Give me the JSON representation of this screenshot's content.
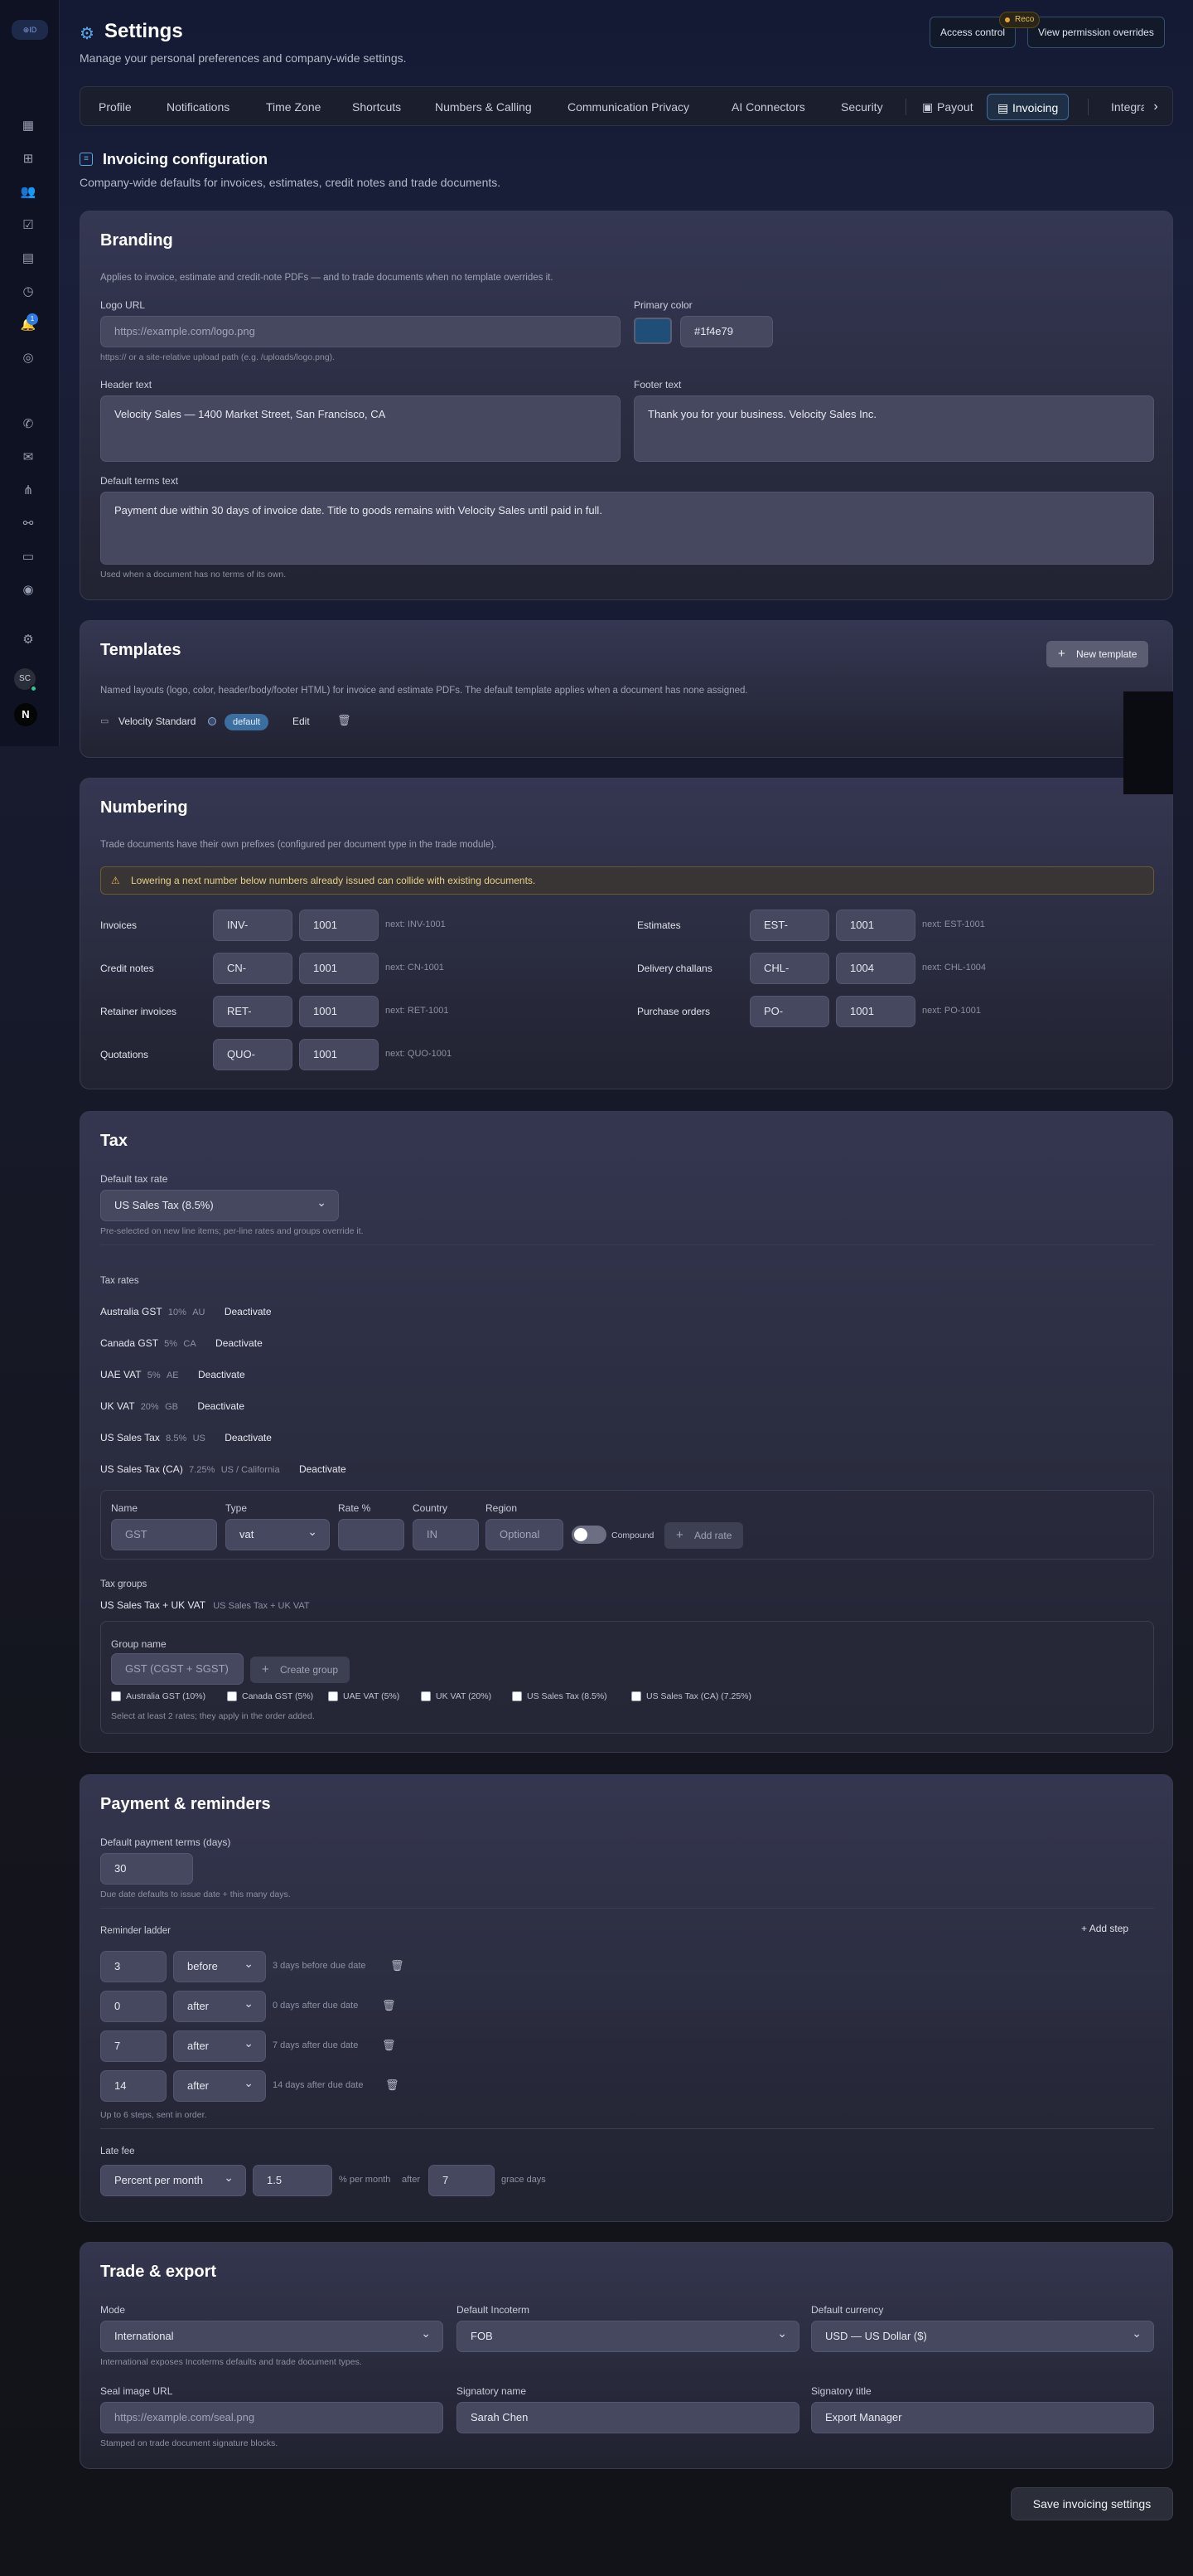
{
  "header": {
    "title": "Settings",
    "subtitle": "Manage your personal preferences and company-wide settings.",
    "access_control": "Access control",
    "view_overrides": "View permission overrides",
    "recording": "Reco"
  },
  "rail": {
    "logo": "⊕ID",
    "notif_count": "1",
    "user_initials": "SC",
    "workspace": "N"
  },
  "tabs": [
    "Profile",
    "Notifications",
    "Time Zone",
    "Shortcuts",
    "Numbers & Calling",
    "Communication Privacy",
    "AI Connectors",
    "Security",
    "Payout",
    "Invoicing",
    "Integra"
  ],
  "section": {
    "title": "Invoicing configuration",
    "subtitle": "Company-wide defaults for invoices, estimates, credit notes and trade documents."
  },
  "branding": {
    "title": "Branding",
    "desc": "Applies to invoice, estimate and credit-note PDFs — and to trade documents when no template overrides it.",
    "logo_label": "Logo URL",
    "logo_placeholder": "https://example.com/logo.png",
    "logo_hint": "https:// or a site-relative upload path (e.g. /uploads/logo.png).",
    "color_label": "Primary color",
    "color_value": "#1f4e79",
    "header_label": "Header text",
    "header_value": "Velocity Sales — 1400 Market Street, San Francisco, CA",
    "footer_label": "Footer text",
    "footer_value": "Thank you for your business. Velocity Sales Inc.",
    "terms_label": "Default terms text",
    "terms_value": "Payment due within 30 days of invoice date. Title to goods remains with Velocity Sales until paid in full.",
    "terms_hint": "Used when a document has no terms of its own."
  },
  "templates": {
    "title": "Templates",
    "new_button": "New template",
    "desc": "Named layouts (logo, color, header/body/footer HTML) for invoice and estimate PDFs. The default template applies when a document has none assigned.",
    "name": "Velocity Standard",
    "badge": "default",
    "edit": "Edit"
  },
  "numbering": {
    "title": "Numbering",
    "desc": "Trade documents have their own prefixes (configured per document type in the trade module).",
    "warning": "Lowering a next number below numbers already issued can collide with existing documents.",
    "rows": [
      {
        "label": "Invoices",
        "prefix": "INV-",
        "next": "1001",
        "hint": "next: INV-1001"
      },
      {
        "label": "Estimates",
        "prefix": "EST-",
        "next": "1001",
        "hint": "next: EST-1001"
      },
      {
        "label": "Credit notes",
        "prefix": "CN-",
        "next": "1001",
        "hint": "next: CN-1001"
      },
      {
        "label": "Delivery challans",
        "prefix": "CHL-",
        "next": "1004",
        "hint": "next: CHL-1004"
      },
      {
        "label": "Retainer invoices",
        "prefix": "RET-",
        "next": "1001",
        "hint": "next: RET-1001"
      },
      {
        "label": "Purchase orders",
        "prefix": "PO-",
        "next": "1001",
        "hint": "next: PO-1001"
      },
      {
        "label": "Quotations",
        "prefix": "QUO-",
        "next": "1001",
        "hint": "next: QUO-1001"
      }
    ]
  },
  "tax": {
    "title": "Tax",
    "default_label": "Default tax rate",
    "default_value": "US Sales Tax (8.5%)",
    "default_hint": "Pre-selected on new line items; per-line rates and groups override it.",
    "rates_label": "Tax rates",
    "deactivate": "Deactivate",
    "rates": [
      {
        "name": "Australia GST",
        "rate": "10%",
        "region": "AU"
      },
      {
        "name": "Canada GST",
        "rate": "5%",
        "region": "CA"
      },
      {
        "name": "UAE VAT",
        "rate": "5%",
        "region": "AE"
      },
      {
        "name": "UK VAT",
        "rate": "20%",
        "region": "GB"
      },
      {
        "name": "US Sales Tax",
        "rate": "8.5%",
        "region": "US"
      },
      {
        "name": "US Sales Tax (CA)",
        "rate": "7.25%",
        "region": "US / California"
      }
    ],
    "form": {
      "name_label": "Name",
      "name_ph": "GST",
      "type_label": "Type",
      "type_value": "vat",
      "rate_label": "Rate %",
      "country_label": "Country",
      "country_ph": "IN",
      "region_label": "Region",
      "region_ph": "Optional",
      "compound": "Compound",
      "add": "Add rate"
    },
    "groups_label": "Tax groups",
    "group_name": "US Sales Tax + UK VAT",
    "group_members": "US Sales Tax + UK VAT",
    "group_form": {
      "label": "Group name",
      "placeholder": "GST (CGST + SGST)",
      "create": "Create group",
      "options": [
        "Australia GST (10%)",
        "Canada GST (5%)",
        "UAE VAT (5%)",
        "UK VAT (20%)",
        "US Sales Tax (8.5%)",
        "US Sales Tax (CA) (7.25%)"
      ],
      "hint": "Select at least 2 rates; they apply in the order added."
    }
  },
  "payment": {
    "title": "Payment & reminders",
    "terms_label": "Default payment terms (days)",
    "terms_value": "30",
    "terms_hint": "Due date defaults to issue date + this many days.",
    "ladder_label": "Reminder ladder",
    "add_step": "Add step",
    "steps": [
      {
        "days": "3",
        "when": "before",
        "desc": "3 days before due date"
      },
      {
        "days": "0",
        "when": "after",
        "desc": "0 days after due date"
      },
      {
        "days": "7",
        "when": "after",
        "desc": "7 days after due date"
      },
      {
        "days": "14",
        "when": "after",
        "desc": "14 days after due date"
      }
    ],
    "ladder_hint": "Up to 6 steps, sent in order.",
    "late_label": "Late fee",
    "late_mode": "Percent per month",
    "late_value": "1.5",
    "late_unit": "% per month",
    "after": "after",
    "grace": "7",
    "grace_unit": "grace days"
  },
  "trade": {
    "title": "Trade & export",
    "mode_label": "Mode",
    "mode_value": "International",
    "mode_hint": "International exposes Incoterms defaults and trade document types.",
    "incoterm_label": "Default Incoterm",
    "incoterm_value": "FOB",
    "currency_label": "Default currency",
    "currency_value": "USD — US Dollar ($)",
    "seal_label": "Seal image URL",
    "seal_ph": "https://example.com/seal.png",
    "seal_hint": "Stamped on trade document signature blocks.",
    "signatory_label": "Signatory name",
    "signatory_value": "Sarah Chen",
    "title_label": "Signatory title",
    "title_value": "Export Manager"
  },
  "save": "Save invoicing settings"
}
